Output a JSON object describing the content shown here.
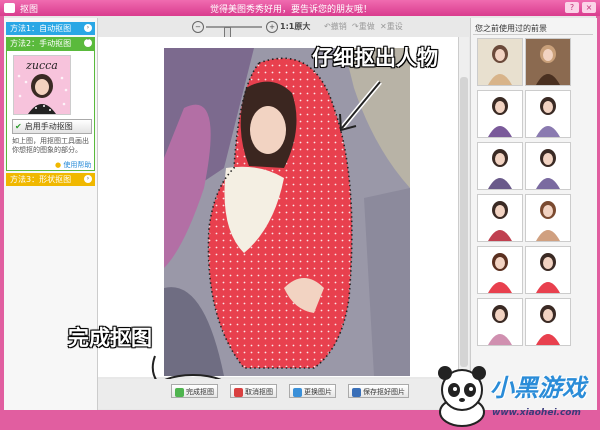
{
  "window": {
    "title": "抠图",
    "slogan": "觉得美图秀秀好用，要告诉您的朋友哦！",
    "buttons": [
      "?",
      "×"
    ]
  },
  "left_panel": {
    "method1": "方法1：自动抠图",
    "method2": "方法2：手动抠图",
    "method3": "方法3：形状抠图",
    "thumb_brand": "zucca",
    "manual_button": "启用手动抠图",
    "help_text": "如上图，用抠图工具画出你想抠的图象的部分。",
    "help_link": "使用帮助"
  },
  "toolbar": {
    "zoom_out_icon": "zoom-out-icon",
    "zoom_in_icon": "zoom-in-icon",
    "zoom_level": 0.35,
    "original_size": "1:1原大",
    "undo": "撤销",
    "redo": "重做",
    "clear": "重设"
  },
  "annotations": {
    "cutout_hint": "仔细抠出人物",
    "finish_hint": "完成抠图"
  },
  "bottom_bar": {
    "finish": "完成抠图",
    "cancel": "取消抠图",
    "change_image": "更换图片",
    "save_image": "保存抠好图片"
  },
  "right_panel": {
    "title": "您之前使用过的前景"
  },
  "watermark": {
    "logo_text": "小黑游戏",
    "url": "www.xiaohei.com"
  },
  "colors": {
    "accent_pink": "#e15ea0",
    "method1": "#2aa7e5",
    "method2": "#5aba3c",
    "method3": "#f0b800",
    "jacket_red": "#e8404e"
  }
}
